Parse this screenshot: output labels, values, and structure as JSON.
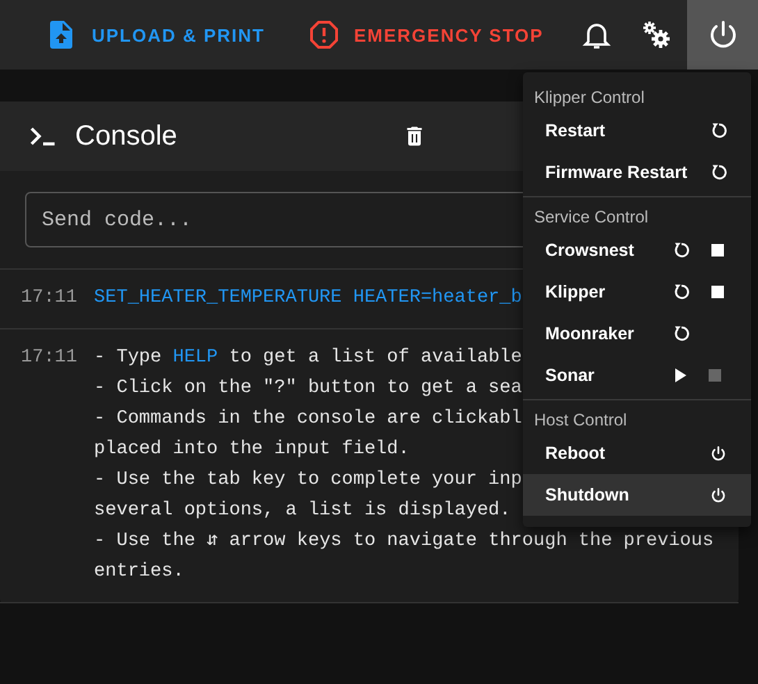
{
  "top_bar": {
    "upload_button": "UPLOAD & PRINT",
    "emergency_button": "EMERGENCY STOP",
    "power_button_active": true
  },
  "console": {
    "title": "Console",
    "input": {
      "placeholder": "Send code..."
    },
    "entries": [
      {
        "time": "17:11",
        "lines": [
          [
            {
              "text": "SET_HEATER_TEMPERATURE HEATER=heater_b",
              "link": true
            }
          ]
        ]
      },
      {
        "time": "17:11",
        "lines": [
          [
            {
              "text": "- Type ",
              "link": false
            },
            {
              "text": "HELP",
              "link": true
            },
            {
              "text": " to get a list of available",
              "link": false
            }
          ],
          [
            {
              "text": "- Click on the \"?\" button to get a sea",
              "link": false
            }
          ],
          [
            {
              "text": "- Commands in the console are clickabl",
              "link": false
            }
          ],
          [
            {
              "text": "placed into the input field.",
              "link": false
            }
          ],
          [
            {
              "text": "- Use the tab key to complete your inp",
              "link": false
            }
          ],
          [
            {
              "text": "several options, a list is displayed.",
              "link": false
            }
          ],
          [
            {
              "text": "- Use the ⇵ arrow keys to navigate through the previous",
              "link": false
            }
          ],
          [
            {
              "text": "entries.",
              "link": false
            }
          ]
        ]
      }
    ]
  },
  "power_menu": {
    "sections": [
      {
        "title": "Klipper Control",
        "items": [
          {
            "label": "Restart",
            "highlighted": false,
            "actions": [
              {
                "kind": "restart",
                "disabled": false
              }
            ]
          },
          {
            "label": "Firmware Restart",
            "highlighted": false,
            "actions": [
              {
                "kind": "restart",
                "disabled": false
              }
            ]
          }
        ]
      },
      {
        "title": "Service Control",
        "items": [
          {
            "label": "Crowsnest",
            "highlighted": false,
            "actions": [
              {
                "kind": "restart",
                "disabled": false
              },
              {
                "kind": "stop",
                "disabled": false
              }
            ]
          },
          {
            "label": "Klipper",
            "highlighted": false,
            "actions": [
              {
                "kind": "restart",
                "disabled": false
              },
              {
                "kind": "stop",
                "disabled": false
              }
            ]
          },
          {
            "label": "Moonraker",
            "highlighted": false,
            "actions": [
              {
                "kind": "restart",
                "disabled": false
              }
            ]
          },
          {
            "label": "Sonar",
            "highlighted": false,
            "actions": [
              {
                "kind": "start",
                "disabled": false
              },
              {
                "kind": "stop",
                "disabled": true
              }
            ]
          }
        ]
      },
      {
        "title": "Host Control",
        "items": [
          {
            "label": "Reboot",
            "highlighted": false,
            "actions": [
              {
                "kind": "power",
                "disabled": false
              }
            ]
          },
          {
            "label": "Shutdown",
            "highlighted": true,
            "actions": [
              {
                "kind": "power",
                "disabled": false
              }
            ]
          }
        ]
      }
    ]
  }
}
